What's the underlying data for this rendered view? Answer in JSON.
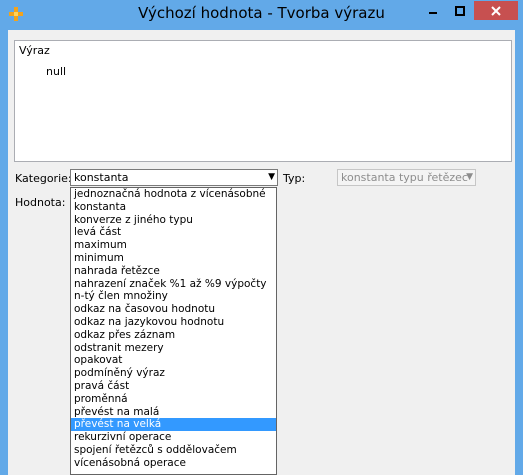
{
  "window": {
    "title": "Výchozí hodnota - Tvorba výrazu"
  },
  "expression": {
    "label": "Výraz",
    "value": "null"
  },
  "form": {
    "category_label": "Kategorie:",
    "category_value": "konstanta",
    "type_label": "Typ:",
    "type_value": "konstanta typu řetězec",
    "value_label": "Hodnota:"
  },
  "dropdown": {
    "items": [
      "jednoznačná hodnota z vícenásobné",
      "konstanta",
      "konverze z jiného typu",
      "levá část",
      "maximum",
      "minimum",
      "nahrada řetězce",
      "nahrazení značek %1 až %9 výpočty",
      "n-tý člen množiny",
      "odkaz na časovou hodnotu",
      "odkaz na jazykovou hodnotu",
      "odkaz přes záznam",
      "odstranit mezery",
      "opakovat",
      "podmíněný výraz",
      "pravá část",
      "proměnná",
      "převést na malá",
      "převést na velká",
      "rekurzivní operace",
      "spojení řetězců s oddělovačem",
      "vícenásobná operace"
    ],
    "selected_index": 18
  },
  "colors": {
    "titlebar": "#62a9e8",
    "close_button": "#c75050",
    "selection": "#3399ff"
  }
}
